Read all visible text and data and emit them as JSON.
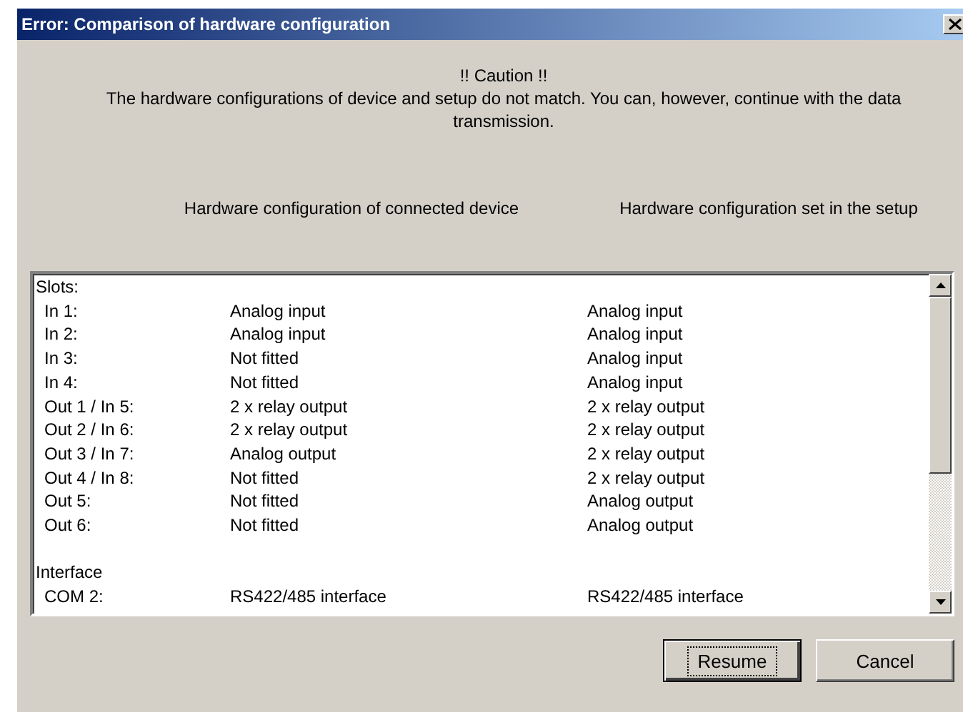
{
  "window": {
    "title": "Error: Comparison of hardware configuration"
  },
  "caution": "!! Caution !!",
  "message": "The hardware configurations of device and setup do not match. You can, however, continue with the data transmission.",
  "column_headings": [
    "Hardware configuration of connected device",
    "Hardware configuration set in the setup"
  ],
  "list": {
    "sections": [
      {
        "title": "Slots:",
        "rows": [
          {
            "label": "In 1:",
            "device": "Analog input",
            "setup": "Analog input"
          },
          {
            "label": "In 2:",
            "device": "Analog input",
            "setup": "Analog input"
          },
          {
            "label": "In 3:",
            "device": "Not fitted",
            "setup": "Analog input"
          },
          {
            "label": "In 4:",
            "device": "Not fitted",
            "setup": "Analog input"
          },
          {
            "label": "Out 1 / In 5:",
            "device": "2 x relay output",
            "setup": "2 x relay output"
          },
          {
            "label": "Out 2 / In 6:",
            "device": "2 x relay output",
            "setup": "2 x relay output"
          },
          {
            "label": "Out 3 / In 7:",
            "device": "Analog output",
            "setup": "2 x relay output"
          },
          {
            "label": "Out 4 / In 8:",
            "device": "Not fitted",
            "setup": "2 x relay output"
          },
          {
            "label": "Out 5:",
            "device": "Not fitted",
            "setup": "Analog output"
          },
          {
            "label": "Out 6:",
            "device": "Not fitted",
            "setup": "Analog output"
          }
        ]
      },
      {
        "title": "Interface",
        "rows": [
          {
            "label": "COM 2:",
            "device": "RS422/485 interface",
            "setup": "RS422/485 interface"
          }
        ]
      }
    ]
  },
  "buttons": [
    {
      "label": "Resume",
      "focused": true
    },
    {
      "label": "Cancel",
      "focused": false
    }
  ]
}
